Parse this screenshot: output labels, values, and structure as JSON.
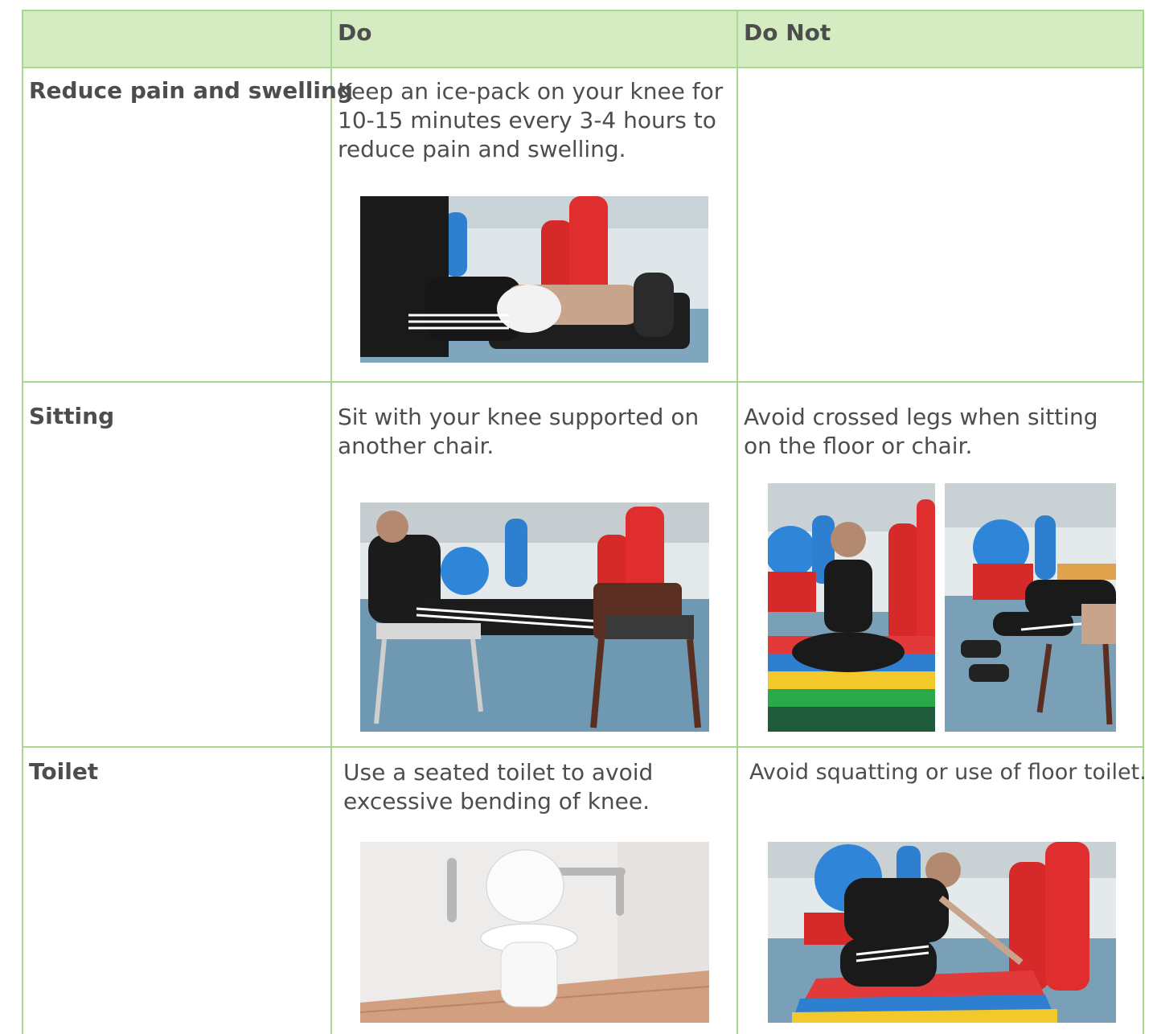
{
  "header": {
    "col1": "",
    "col2": "Do",
    "col3": "Do Not"
  },
  "rows": [
    {
      "label": "Reduce pain and swelling",
      "do_text": "Keep an ice-pack on your knee for 10-15 minutes every 3-4 hours to reduce pain and swelling.",
      "do_not_text": ""
    },
    {
      "label": "Sitting",
      "do_text": "Sit with your knee supported on another chair.",
      "do_not_text": "Avoid crossed legs when sitting on the floor or chair."
    },
    {
      "label": "Toilet",
      "do_text": "Use a seated toilet to avoid excessive bending of knee.",
      "do_not_text": "Avoid squatting or use of floor toilet."
    }
  ],
  "colors": {
    "header_bg": "#d5ecc3",
    "border": "#a9d78f",
    "text": "#4d4d4d"
  }
}
